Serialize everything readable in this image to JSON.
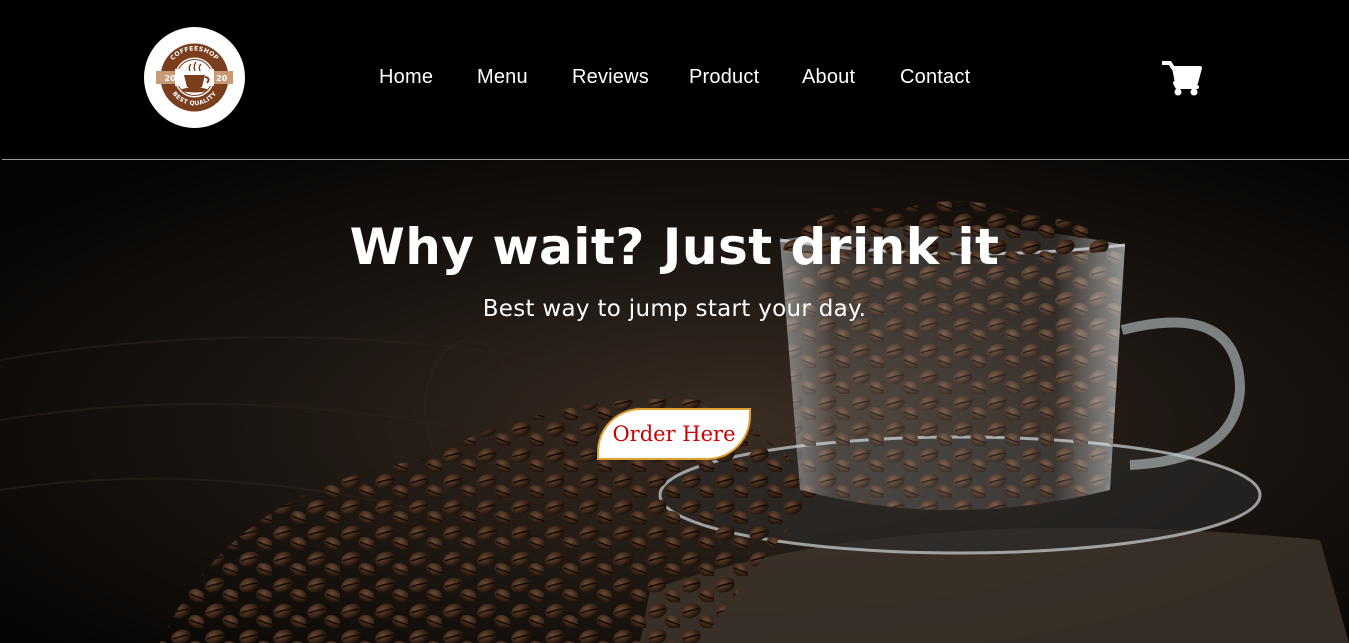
{
  "logo": {
    "text_top": "COFFEESHOP",
    "text_bottom": "BEST QUALITY",
    "year_left": "20",
    "year_right": "20"
  },
  "nav": {
    "items": [
      {
        "label": "Home"
      },
      {
        "label": "Menu"
      },
      {
        "label": "Reviews"
      },
      {
        "label": "Product"
      },
      {
        "label": "About"
      },
      {
        "label": "Contact"
      }
    ]
  },
  "cart": {
    "icon": "shopping-cart-icon"
  },
  "hero": {
    "title": "Why wait? Just drink it",
    "subtitle": "Best way to jump start your day.",
    "cta_label": "Order Here"
  },
  "colors": {
    "background": "#000000",
    "text": "#ffffff",
    "cta_text": "#cc0000",
    "cta_border": "#e0a030",
    "logo_brown": "#7a3e1d"
  }
}
